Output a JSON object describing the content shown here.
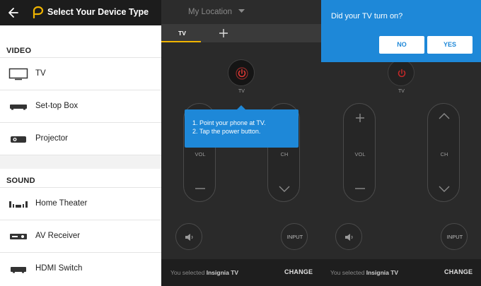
{
  "device_picker": {
    "title": "Select Your Device Type",
    "sections": [
      {
        "header": "VIDEO",
        "items": [
          {
            "label": "TV",
            "icon": "tv-icon"
          },
          {
            "label": "Set-top Box",
            "icon": "set-top-box-icon"
          },
          {
            "label": "Projector",
            "icon": "projector-icon"
          }
        ]
      },
      {
        "header": "SOUND",
        "items": [
          {
            "label": "Home Theater",
            "icon": "home-theater-icon"
          },
          {
            "label": "AV Receiver",
            "icon": "av-receiver-icon"
          },
          {
            "label": "HDMI Switch",
            "icon": "hdmi-switch-icon"
          }
        ]
      }
    ]
  },
  "remote": {
    "location": "My Location",
    "tab_label": "TV",
    "power_label": "TV",
    "vol_label": "VOL",
    "ch_label": "CH",
    "input_label": "INPUT",
    "selected_prefix": "You selected",
    "selected_device": "Insignia TV",
    "change_label": "CHANGE",
    "instructions": [
      "1. Point your phone at TV.",
      "2. Tap the power button."
    ]
  },
  "confirm_dialog": {
    "question": "Did your TV turn on?",
    "no_label": "NO",
    "yes_label": "YES"
  },
  "colors": {
    "accent_yellow": "#f0b400",
    "dialog_blue": "#1e88d8",
    "power_red": "#e53935"
  }
}
